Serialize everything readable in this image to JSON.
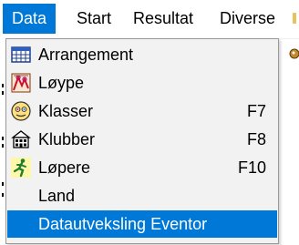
{
  "menubar": {
    "items": [
      {
        "label": "Data",
        "active": true
      },
      {
        "label": "Start",
        "active": false
      },
      {
        "label": "Resultat",
        "active": false
      },
      {
        "label": "Diverse",
        "active": false
      }
    ]
  },
  "dropdown": {
    "items": [
      {
        "label": "Arrangement",
        "shortcut": "",
        "icon": "calendar-grid-icon"
      },
      {
        "label": "Løype",
        "shortcut": "",
        "icon": "course-map-icon"
      },
      {
        "label": "Klasser",
        "shortcut": "F7",
        "icon": "classes-face-icon"
      },
      {
        "label": "Klubber",
        "shortcut": "F8",
        "icon": "clubs-building-icon"
      },
      {
        "label": "Løpere",
        "shortcut": "F10",
        "icon": "runner-icon"
      },
      {
        "label": "Land",
        "shortcut": "",
        "icon": ""
      },
      {
        "label": "Datautveksling Eventor",
        "shortcut": "",
        "icon": "",
        "highlighted": true
      }
    ]
  },
  "colors": {
    "highlight": "#0078d7",
    "menu_background": "#f2f2f2",
    "menu_border": "#999999"
  }
}
